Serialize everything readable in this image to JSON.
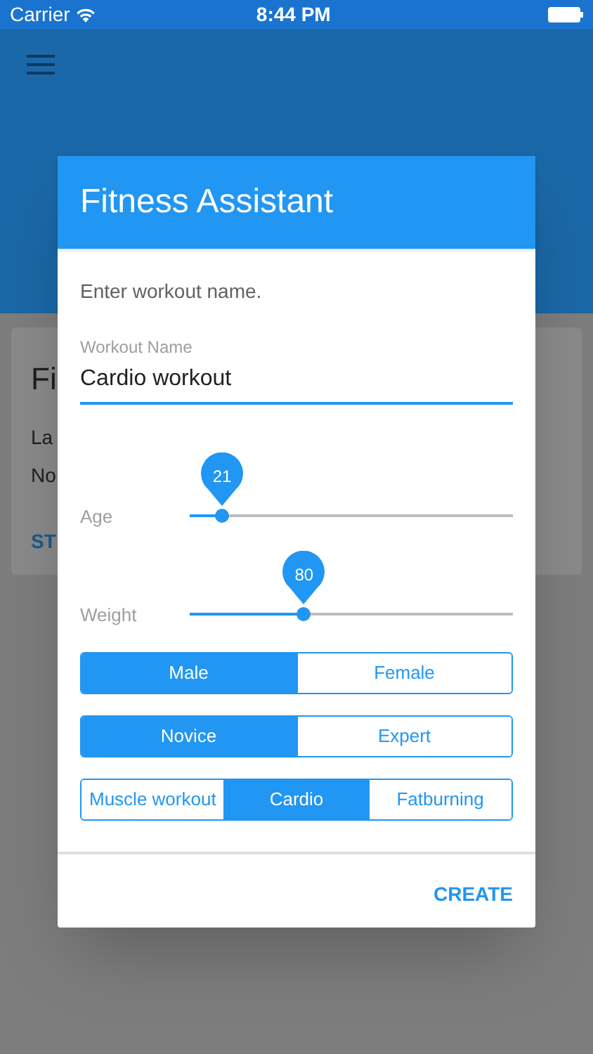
{
  "status_bar": {
    "carrier": "Carrier",
    "time": "8:44 PM"
  },
  "card": {
    "title": "Fi",
    "lines": [
      "La",
      "No"
    ],
    "action": "ST"
  },
  "dialog": {
    "title": "Fitness Assistant",
    "prompt": "Enter workout name.",
    "field": {
      "label": "Workout Name",
      "value": "Cardio workout"
    },
    "sliders": [
      {
        "label": "Age",
        "reading": "21",
        "level": 0.1
      },
      {
        "label": "Weight",
        "reading": "80",
        "level": 0.354
      }
    ],
    "segments": [
      [
        {
          "label": "Male",
          "selected": true
        },
        {
          "label": "Female",
          "selected": false
        }
      ],
      [
        {
          "label": "Novice",
          "selected": true
        },
        {
          "label": "Expert",
          "selected": false
        }
      ],
      [
        {
          "label": "Muscle workout",
          "selected": false
        },
        {
          "label": "Cardio",
          "selected": true
        },
        {
          "label": "Fatburning",
          "selected": false
        }
      ]
    ],
    "action": "CREATE"
  }
}
